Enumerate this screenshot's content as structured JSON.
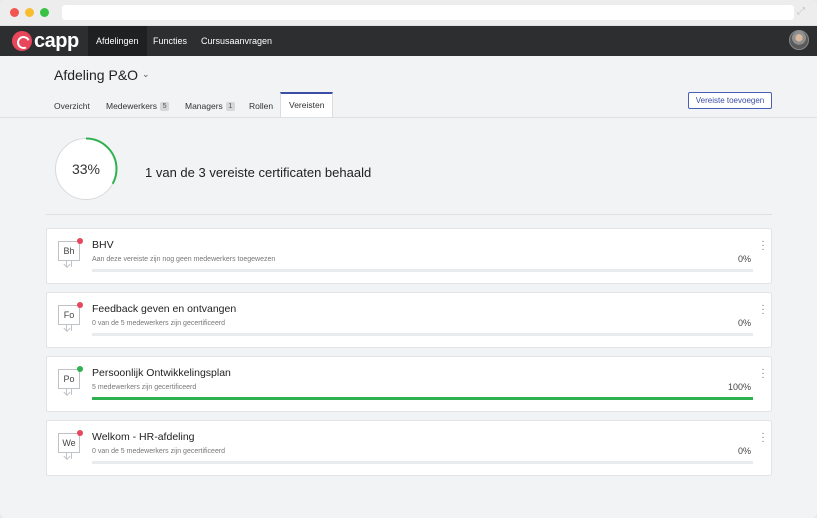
{
  "nav": {
    "logo_text": "capp",
    "items": [
      {
        "label": "Afdelingen",
        "active": true
      },
      {
        "label": "Functies",
        "active": false
      },
      {
        "label": "Cursusaanvragen",
        "active": false
      }
    ]
  },
  "header": {
    "title": "Afdeling P&O",
    "tabs": [
      {
        "label": "Overzicht",
        "badge": ""
      },
      {
        "label": "Medewerkers",
        "badge": "5"
      },
      {
        "label": "Managers",
        "badge": "1"
      },
      {
        "label": "Rollen",
        "badge": ""
      },
      {
        "label": "Vereisten",
        "badge": "",
        "active": true
      }
    ],
    "add_button": "Vereiste toevoegen"
  },
  "summary": {
    "percent_label": "33%",
    "percent_value": 33,
    "text": "1 van de 3 vereiste certificaten behaald"
  },
  "colors": {
    "accent": "#3b4fa6",
    "success": "#2fb14f",
    "alert": "#e8475b"
  },
  "requirements": [
    {
      "abbr": "Bh",
      "title": "BHV",
      "subtitle": "Aan deze vereiste zijn nog geen medewerkers toegewezen",
      "percent_label": "0%",
      "progress": 0,
      "status": "alert"
    },
    {
      "abbr": "Fo",
      "title": "Feedback geven en ontvangen",
      "subtitle": "0 van de 5 medewerkers zijn gecertificeerd",
      "percent_label": "0%",
      "progress": 0,
      "status": "alert"
    },
    {
      "abbr": "Po",
      "title": "Persoonlijk Ontwikkelingsplan",
      "subtitle": "5 medewerkers zijn gecertificeerd",
      "percent_label": "100%",
      "progress": 100,
      "status": "success"
    },
    {
      "abbr": "We",
      "title": "Welkom - HR-afdeling",
      "subtitle": "0 van de 5 medewerkers zijn gecertificeerd",
      "percent_label": "0%",
      "progress": 0,
      "status": "alert"
    }
  ]
}
